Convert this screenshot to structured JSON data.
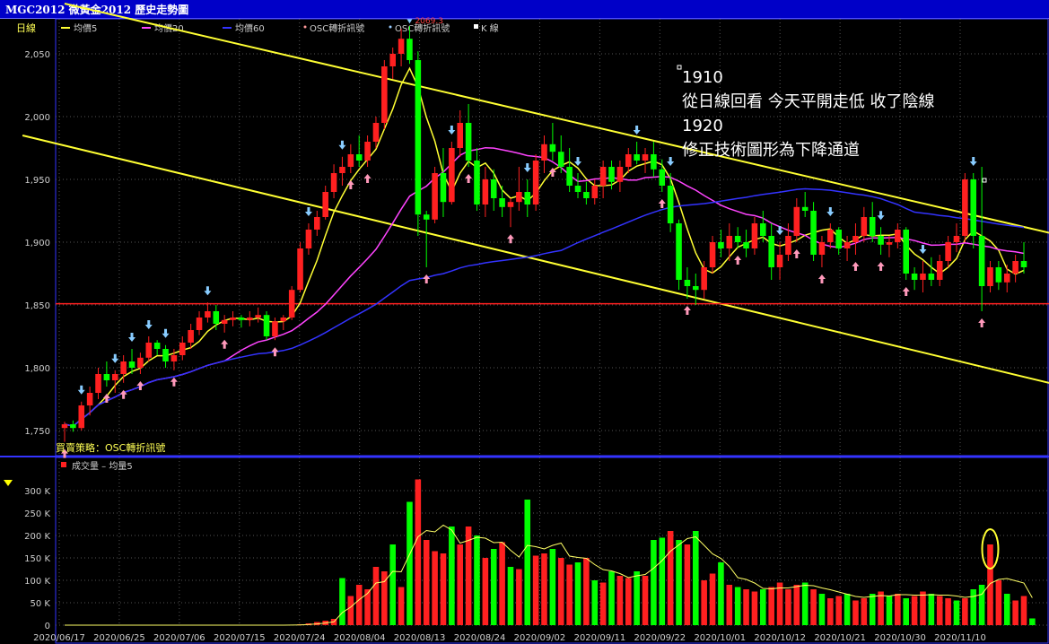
{
  "window_title": "MGC2012 微黃金2012  歷史走勢圖",
  "price_panel": {
    "label": "日線",
    "legend": [
      {
        "text": "均價5",
        "color": "#ffff33",
        "kind": "line"
      },
      {
        "text": "均價20",
        "color": "#ff44ff",
        "kind": "line"
      },
      {
        "text": "均價60",
        "color": "#3333ff",
        "kind": "line"
      },
      {
        "text": "OSC轉折訊號",
        "color": "#ff9999",
        "kind": "dot"
      },
      {
        "text": "OSC轉折訊號",
        "color": "#99ccff",
        "kind": "dot"
      },
      {
        "text": "K 線",
        "color": "#ffffff",
        "kind": "square"
      }
    ],
    "strategy_label": "買賣策略：OSC轉折訊號",
    "high_marker": "2069.3",
    "annotation_lines": [
      "1910",
      "從日線回看 今天平開走低  收了陰線",
      "1920",
      "修正技術圖形為下降通道"
    ]
  },
  "volume_panel": {
    "legend_text": "成交量 – 均量5",
    "volume_color": "#ff2020",
    "up_color": "#00ff00",
    "down_color": "#ff2020",
    "avg_color": "#ffff66"
  },
  "chart_data": [
    {
      "type": "candlestick",
      "title": "",
      "y_ticks": [
        "2,050",
        "2,000",
        "1,950",
        "1,900",
        "1,850",
        "1,800",
        "1,750"
      ],
      "ylim": [
        1740,
        2090
      ],
      "x_ticks": [
        "2020/06/17",
        "2020/06/25",
        "2020/07/06",
        "2020/07/15",
        "2020/07/24",
        "2020/08/04",
        "2020/08/13",
        "2020/08/24",
        "2020/09/02",
        "2020/09/11",
        "2020/09/22",
        "2020/10/01",
        "2020/10/12",
        "2020/10/21",
        "2020/10/30",
        "2020/11/10"
      ],
      "horizontal_line": 1851,
      "candles": [
        [
          1752,
          1757,
          1741,
          1755
        ],
        [
          1755,
          1758,
          1749,
          1752
        ],
        [
          1752,
          1773,
          1750,
          1770
        ],
        [
          1770,
          1785,
          1762,
          1780
        ],
        [
          1780,
          1800,
          1775,
          1795
        ],
        [
          1795,
          1805,
          1785,
          1790
        ],
        [
          1790,
          1798,
          1780,
          1795
        ],
        [
          1795,
          1810,
          1788,
          1805
        ],
        [
          1805,
          1815,
          1795,
          1800
        ],
        [
          1800,
          1812,
          1795,
          1808
        ],
        [
          1808,
          1825,
          1805,
          1820
        ],
        [
          1820,
          1822,
          1810,
          1815
        ],
        [
          1815,
          1818,
          1800,
          1805
        ],
        [
          1805,
          1815,
          1798,
          1810
        ],
        [
          1810,
          1825,
          1806,
          1820
        ],
        [
          1820,
          1835,
          1815,
          1830
        ],
        [
          1830,
          1845,
          1826,
          1840
        ],
        [
          1840,
          1852,
          1836,
          1845
        ],
        [
          1845,
          1850,
          1830,
          1835
        ],
        [
          1835,
          1842,
          1828,
          1838
        ],
        [
          1838,
          1845,
          1833,
          1840
        ],
        [
          1840,
          1842,
          1832,
          1838
        ],
        [
          1838,
          1845,
          1833,
          1840
        ],
        [
          1840,
          1848,
          1836,
          1842
        ],
        [
          1842,
          1845,
          1822,
          1825
        ],
        [
          1825,
          1840,
          1822,
          1837
        ],
        [
          1837,
          1842,
          1830,
          1840
        ],
        [
          1840,
          1865,
          1838,
          1862
        ],
        [
          1862,
          1900,
          1860,
          1895
        ],
        [
          1895,
          1915,
          1890,
          1910
        ],
        [
          1910,
          1925,
          1905,
          1920
        ],
        [
          1920,
          1945,
          1918,
          1940
        ],
        [
          1940,
          1962,
          1935,
          1955
        ],
        [
          1955,
          1968,
          1945,
          1960
        ],
        [
          1960,
          1978,
          1955,
          1970
        ],
        [
          1970,
          1985,
          1960,
          1965
        ],
        [
          1965,
          1985,
          1960,
          1980
        ],
        [
          1980,
          2000,
          1975,
          1995
        ],
        [
          1995,
          2045,
          1990,
          2040
        ],
        [
          2040,
          2055,
          2030,
          2050
        ],
        [
          2050,
          2070,
          2040,
          2062
        ],
        [
          2062,
          2072,
          2042,
          2045
        ],
        [
          2045,
          2052,
          1905,
          1922
        ],
        [
          1922,
          1925,
          1880,
          1918
        ],
        [
          1918,
          1960,
          1915,
          1955
        ],
        [
          1955,
          1975,
          1920,
          1932
        ],
        [
          1932,
          1980,
          1930,
          1975
        ],
        [
          1975,
          2005,
          1968,
          1995
        ],
        [
          1995,
          2010,
          1960,
          1965
        ],
        [
          1965,
          1975,
          1925,
          1930
        ],
        [
          1930,
          1960,
          1920,
          1950
        ],
        [
          1950,
          1958,
          1925,
          1935
        ],
        [
          1935,
          1945,
          1920,
          1928
        ],
        [
          1928,
          1935,
          1912,
          1932
        ],
        [
          1932,
          1960,
          1925,
          1940
        ],
        [
          1940,
          1950,
          1920,
          1930
        ],
        [
          1930,
          1970,
          1925,
          1965
        ],
        [
          1965,
          1985,
          1955,
          1978
        ],
        [
          1978,
          1995,
          1965,
          1972
        ],
        [
          1972,
          1985,
          1955,
          1960
        ],
        [
          1960,
          1975,
          1940,
          1945
        ],
        [
          1945,
          1955,
          1935,
          1940
        ],
        [
          1940,
          1948,
          1930,
          1935
        ],
        [
          1935,
          1950,
          1930,
          1945
        ],
        [
          1945,
          1965,
          1935,
          1960
        ],
        [
          1960,
          1965,
          1942,
          1948
        ],
        [
          1948,
          1965,
          1940,
          1960
        ],
        [
          1960,
          1975,
          1955,
          1970
        ],
        [
          1970,
          1980,
          1962,
          1965
        ],
        [
          1965,
          1975,
          1955,
          1970
        ],
        [
          1970,
          1980,
          1952,
          1958
        ],
        [
          1958,
          1966,
          1940,
          1945
        ],
        [
          1945,
          1955,
          1908,
          1915
        ],
        [
          1915,
          1918,
          1862,
          1870
        ],
        [
          1870,
          1880,
          1855,
          1865
        ],
        [
          1865,
          1875,
          1850,
          1862
        ],
        [
          1862,
          1885,
          1855,
          1880
        ],
        [
          1880,
          1905,
          1875,
          1900
        ],
        [
          1900,
          1910,
          1888,
          1895
        ],
        [
          1895,
          1915,
          1885,
          1905
        ],
        [
          1905,
          1912,
          1895,
          1900
        ],
        [
          1900,
          1910,
          1888,
          1895
        ],
        [
          1895,
          1920,
          1890,
          1915
        ],
        [
          1915,
          1925,
          1900,
          1905
        ],
        [
          1905,
          1915,
          1870,
          1880
        ],
        [
          1880,
          1900,
          1870,
          1890
        ],
        [
          1890,
          1915,
          1885,
          1905
        ],
        [
          1905,
          1935,
          1900,
          1928
        ],
        [
          1928,
          1940,
          1920,
          1925
        ],
        [
          1925,
          1932,
          1885,
          1890
        ],
        [
          1890,
          1905,
          1880,
          1900
        ],
        [
          1900,
          1915,
          1895,
          1910
        ],
        [
          1910,
          1912,
          1890,
          1895
        ],
        [
          1895,
          1905,
          1885,
          1900
        ],
        [
          1900,
          1915,
          1890,
          1905
        ],
        [
          1905,
          1928,
          1900,
          1920
        ],
        [
          1920,
          1932,
          1900,
          1905
        ],
        [
          1905,
          1912,
          1890,
          1898
        ],
        [
          1898,
          1905,
          1888,
          1900
        ],
        [
          1900,
          1915,
          1895,
          1910
        ],
        [
          1910,
          1912,
          1870,
          1875
        ],
        [
          1875,
          1880,
          1862,
          1870
        ],
        [
          1870,
          1885,
          1860,
          1875
        ],
        [
          1875,
          1888,
          1865,
          1870
        ],
        [
          1870,
          1890,
          1865,
          1885
        ],
        [
          1885,
          1905,
          1880,
          1900
        ],
        [
          1900,
          1915,
          1892,
          1905
        ],
        [
          1905,
          1955,
          1900,
          1950
        ],
        [
          1950,
          1955,
          1895,
          1905
        ],
        [
          1905,
          1960,
          1845,
          1865
        ],
        [
          1865,
          1885,
          1860,
          1880
        ],
        [
          1880,
          1885,
          1862,
          1868
        ],
        [
          1868,
          1882,
          1860,
          1875
        ],
        [
          1875,
          1890,
          1868,
          1885
        ],
        [
          1885,
          1900,
          1875,
          1880
        ]
      ],
      "buy_signal_index": [
        0,
        5,
        7,
        9,
        13,
        19,
        25,
        34,
        36,
        43,
        48,
        53,
        58,
        71,
        74,
        80,
        87,
        90,
        94,
        97,
        100,
        109
      ],
      "sell_signal_index": [
        2,
        6,
        8,
        10,
        12,
        17,
        29,
        33,
        46,
        55,
        61,
        68,
        72,
        85,
        91,
        97,
        102,
        108
      ],
      "channel_lines": [
        {
          "from": [
            0,
            2090
          ],
          "to": [
            125,
            1895
          ]
        },
        {
          "from": [
            -5,
            1985
          ],
          "to": [
            125,
            1775
          ]
        }
      ]
    },
    {
      "type": "bar",
      "title": "",
      "y_ticks": [
        "300 K",
        "250 K",
        "200 K",
        "150 K",
        "100 K",
        "50 K",
        "0"
      ],
      "ylim": [
        0,
        340
      ],
      "volumes_k": [
        0,
        0,
        0,
        0,
        0,
        0,
        0,
        0,
        0,
        0,
        0,
        0,
        0,
        0,
        0,
        0,
        0,
        0,
        0,
        0,
        0,
        0,
        0,
        0,
        0,
        0,
        0,
        1,
        2,
        4,
        7,
        10,
        14,
        105,
        65,
        90,
        80,
        130,
        120,
        180,
        85,
        275,
        325,
        190,
        165,
        160,
        220,
        180,
        220,
        200,
        150,
        170,
        185,
        130,
        125,
        280,
        155,
        160,
        170,
        150,
        135,
        140,
        150,
        100,
        95,
        120,
        110,
        105,
        120,
        110,
        190,
        195,
        210,
        190,
        180,
        210,
        100,
        115,
        140,
        90,
        85,
        80,
        75,
        80,
        85,
        95,
        80,
        90,
        95,
        80,
        70,
        60,
        65,
        70,
        55,
        60,
        70,
        75,
        65,
        70,
        60,
        65,
        75,
        70,
        65,
        60,
        55,
        60,
        80,
        90,
        180,
        100,
        70,
        55,
        65,
        15
      ],
      "volume_up": [
        0,
        0,
        0,
        0,
        0,
        0,
        0,
        0,
        0,
        0,
        0,
        0,
        0,
        0,
        0,
        0,
        0,
        0,
        0,
        0,
        0,
        0,
        0,
        0,
        0,
        0,
        0,
        0,
        0,
        0,
        0,
        0,
        0,
        1,
        0,
        0,
        0,
        0,
        0,
        1,
        0,
        1,
        0,
        0,
        0,
        0,
        1,
        0,
        0,
        1,
        0,
        1,
        0,
        1,
        0,
        1,
        0,
        0,
        1,
        0,
        0,
        1,
        0,
        1,
        0,
        1,
        0,
        0,
        1,
        0,
        1,
        1,
        0,
        1,
        0,
        1,
        0,
        0,
        1,
        0,
        1,
        0,
        0,
        1,
        0,
        0,
        0,
        0,
        1,
        0,
        1,
        0,
        0,
        1,
        0,
        0,
        1,
        0,
        1,
        0,
        1,
        0,
        0,
        1,
        0,
        0,
        1,
        0,
        1,
        1,
        0,
        0,
        1,
        0,
        0,
        1
      ]
    }
  ]
}
